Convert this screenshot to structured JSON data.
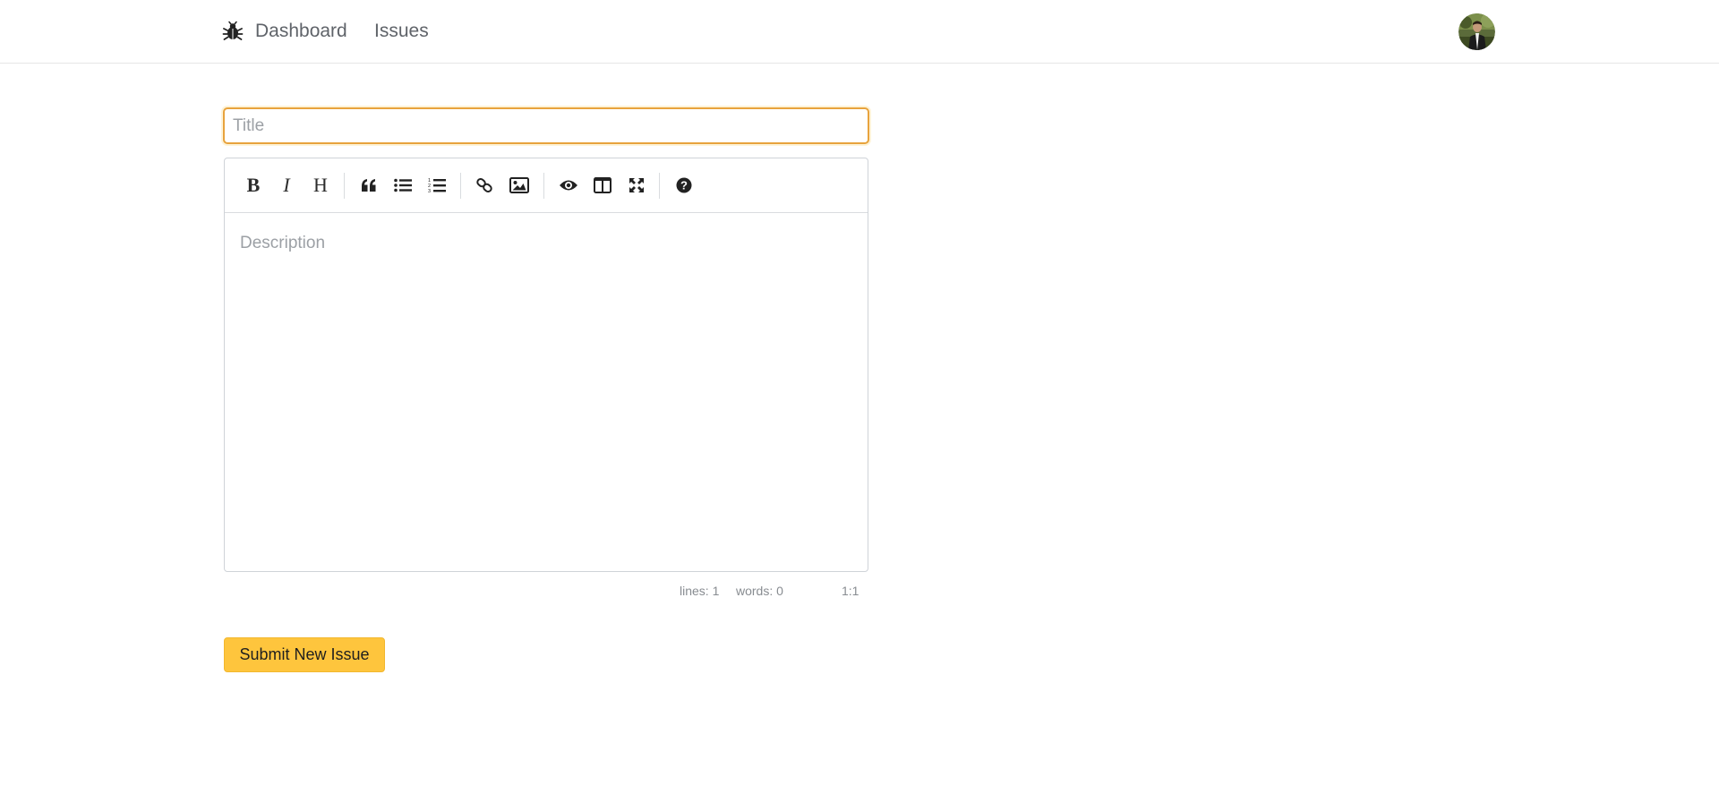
{
  "nav": {
    "logo_icon": "bug-icon",
    "links": [
      {
        "label": "Dashboard"
      },
      {
        "label": "Issues"
      }
    ],
    "avatar_icon": "user-avatar"
  },
  "form": {
    "title_placeholder": "Title",
    "title_value": "",
    "description_placeholder": "Description",
    "description_value": "",
    "submit_label": "Submit New Issue"
  },
  "editor": {
    "toolbar": [
      {
        "name": "bold",
        "icon": "bold-icon",
        "glyph": "B"
      },
      {
        "name": "italic",
        "icon": "italic-icon",
        "glyph": "I"
      },
      {
        "name": "heading",
        "icon": "heading-icon",
        "glyph": "H"
      },
      {
        "name": "quote",
        "icon": "quote-icon"
      },
      {
        "name": "unordered-list",
        "icon": "list-ul-icon"
      },
      {
        "name": "ordered-list",
        "icon": "list-ol-icon"
      },
      {
        "name": "link",
        "icon": "link-icon"
      },
      {
        "name": "image",
        "icon": "image-icon"
      },
      {
        "name": "preview",
        "icon": "eye-icon"
      },
      {
        "name": "side-by-side",
        "icon": "columns-icon"
      },
      {
        "name": "fullscreen",
        "icon": "fullscreen-icon"
      },
      {
        "name": "guide",
        "icon": "help-icon"
      }
    ],
    "status": {
      "lines": "lines: 1",
      "words": "words: 0",
      "cursor": "1:1"
    }
  },
  "colors": {
    "accent": "#fec53d",
    "focus_border": "#e8a33d",
    "nav_text": "#5f6369",
    "placeholder": "#9ca0a5"
  }
}
